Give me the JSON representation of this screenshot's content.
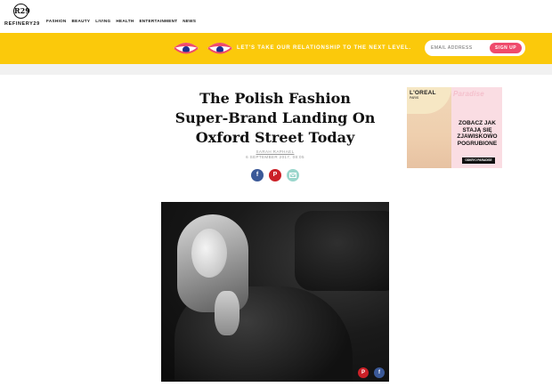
{
  "header": {
    "logo_mark": "R29",
    "logo_text": "REFINERY29",
    "nav": [
      "FASHION",
      "BEAUTY",
      "LIVING",
      "HEALTH",
      "ENTERTAINMENT",
      "NEWS"
    ]
  },
  "banner": {
    "text": "LET'S TAKE OUR RELATIONSHIP TO THE NEXT LEVEL.",
    "email_placeholder": "EMAIL ADDRESS",
    "signup_label": "SIGN UP",
    "bg_color": "#fbc90b",
    "button_color": "#ef4b6c"
  },
  "article": {
    "title": "The Polish Fashion Super-Brand Landing On Oxford Street Today",
    "author": "SARAH RAPHAEL",
    "date": "6 SEPTEMBER 2017, 08:05",
    "share_icons": [
      "facebook-icon",
      "pinterest-icon",
      "email-icon"
    ]
  },
  "ad": {
    "brand": "L'OREAL",
    "brand_sub": "PARIS",
    "headline_word": "Paradise",
    "copy": "ZOBACZ JAK STAJĄ SIĘ ZJAWISKOWO POGRUBIONE",
    "cta": "ODKRYJ PARADISE"
  },
  "hero": {
    "share_icons": [
      "pinterest-icon",
      "facebook-icon"
    ]
  }
}
